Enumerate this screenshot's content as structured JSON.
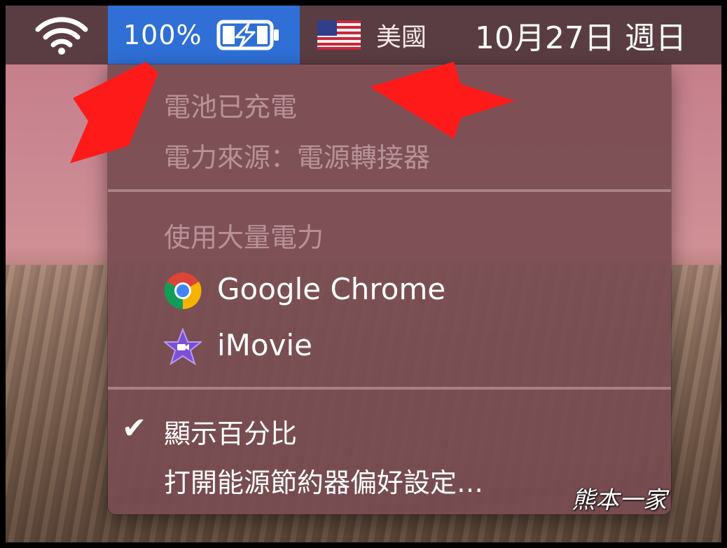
{
  "menubar": {
    "battery_percent": "100%",
    "input_source": "美國",
    "clock": "10月27日 週日"
  },
  "battery_menu": {
    "status": "電池已充電",
    "power_source": "電力來源：電源轉接器",
    "heavy_usage_header": "使用大量電力",
    "apps": [
      {
        "name": "Google Chrome",
        "icon": "chrome-icon"
      },
      {
        "name": "iMovie",
        "icon": "imovie-icon"
      }
    ],
    "show_percentage": "顯示百分比",
    "show_percentage_checked": true,
    "open_energy_prefs": "打開能源節約器偏好設定…"
  },
  "watermark": "熊本一家",
  "colors": {
    "menubar": "#5a3d42",
    "battery_highlight": "#2f6fd6",
    "menu_bg": "#784c52",
    "annotation_arrow": "#ff1a1a"
  }
}
